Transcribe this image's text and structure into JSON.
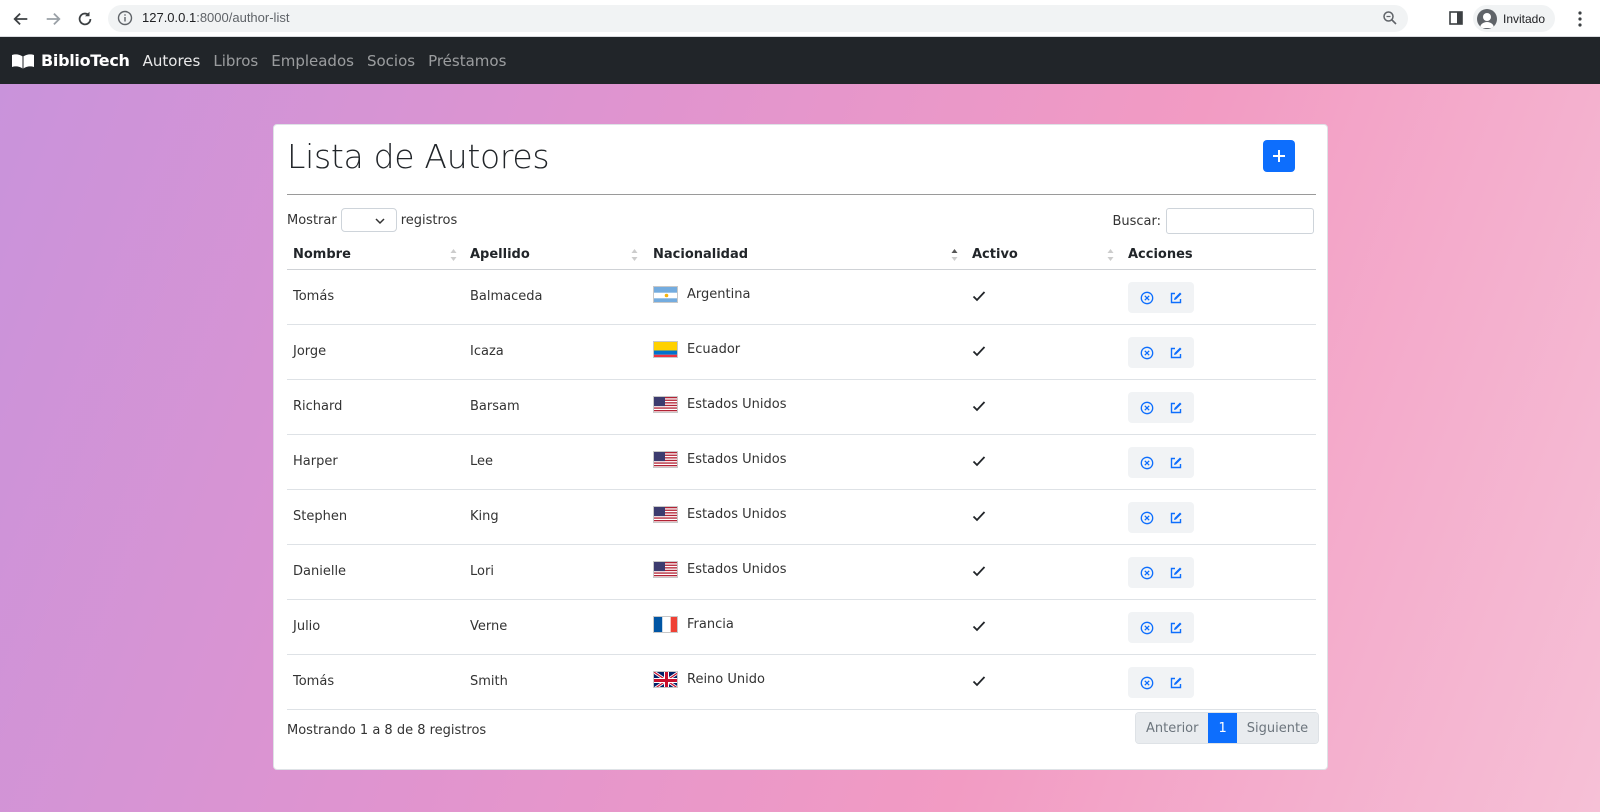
{
  "browser": {
    "url_host": "127.0.0.1",
    "url_path": ":8000/author-list",
    "profile_label": "Invitado"
  },
  "navbar": {
    "brand": "BiblioTech",
    "links": [
      "Autores",
      "Libros",
      "Empleados",
      "Socios",
      "Préstamos"
    ]
  },
  "card": {
    "title": "Lista de Autores",
    "length_label_before": "Mostrar",
    "length_label_after": "registros",
    "search_label": "Buscar:",
    "info": "Mostrando 1 a 8 de 8 registros",
    "pagination": {
      "prev": "Anterior",
      "current": "1",
      "next": "Siguiente"
    }
  },
  "table": {
    "headers": [
      "Nombre",
      "Apellido",
      "Nacionalidad",
      "Activo",
      "Acciones"
    ],
    "rows": [
      {
        "nombre": "Tomás",
        "apellido": "Balmaceda",
        "nacionalidad": "Argentina",
        "flag": "ar"
      },
      {
        "nombre": "Jorge",
        "apellido": "Icaza",
        "nacionalidad": "Ecuador",
        "flag": "ec"
      },
      {
        "nombre": "Richard",
        "apellido": "Barsam",
        "nacionalidad": "Estados Unidos",
        "flag": "us"
      },
      {
        "nombre": "Harper",
        "apellido": "Lee",
        "nacionalidad": "Estados Unidos",
        "flag": "us"
      },
      {
        "nombre": "Stephen",
        "apellido": "King",
        "nacionalidad": "Estados Unidos",
        "flag": "us"
      },
      {
        "nombre": "Danielle",
        "apellido": "Lori",
        "nacionalidad": "Estados Unidos",
        "flag": "us"
      },
      {
        "nombre": "Julio",
        "apellido": "Verne",
        "nacionalidad": "Francia",
        "flag": "fr"
      },
      {
        "nombre": "Tomás",
        "apellido": "Smith",
        "nacionalidad": "Reino Unido",
        "flag": "gb"
      }
    ]
  },
  "colors": {
    "primary": "#0d6efd",
    "navbar": "#212529"
  }
}
